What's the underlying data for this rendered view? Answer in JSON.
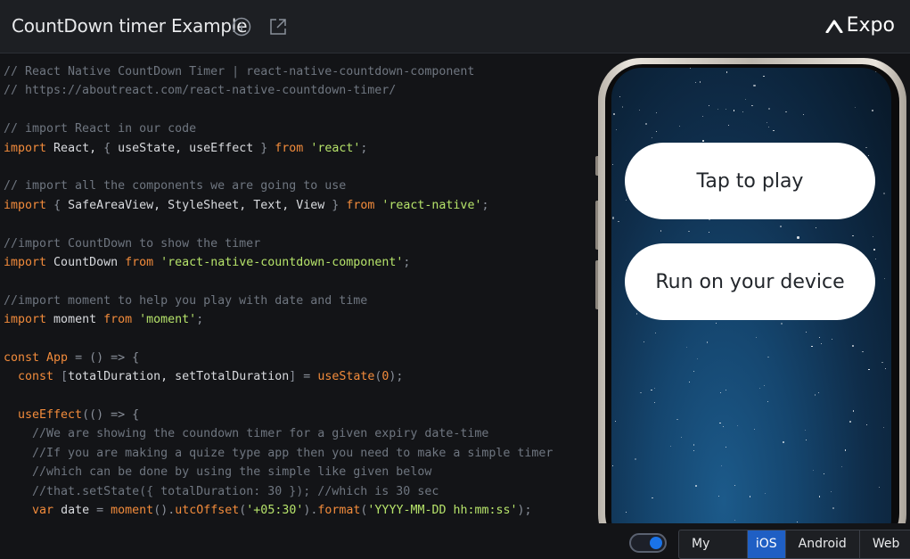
{
  "header": {
    "title": "CountDown timer Example",
    "info_icon": "info-icon",
    "open_icon": "external-link-icon",
    "brand": "Expo"
  },
  "code_lines": [
    [
      {
        "c": "c",
        "t": "// React Native CountDown Timer | react-native-countdown-component"
      }
    ],
    [
      {
        "c": "c",
        "t": "// https://aboutreact.com/react-native-countdown-timer/"
      }
    ],
    [],
    [
      {
        "c": "c",
        "t": "// import React in our code"
      }
    ],
    [
      {
        "c": "k",
        "t": "import"
      },
      {
        "c": "t",
        "t": " React, "
      },
      {
        "c": "p",
        "t": "{"
      },
      {
        "c": "t",
        "t": " useState, useEffect "
      },
      {
        "c": "p",
        "t": "}"
      },
      {
        "c": "t",
        "t": " "
      },
      {
        "c": "k",
        "t": "from"
      },
      {
        "c": "t",
        "t": " "
      },
      {
        "c": "s",
        "t": "'react'"
      },
      {
        "c": "p",
        "t": ";"
      }
    ],
    [],
    [
      {
        "c": "c",
        "t": "// import all the components we are going to use"
      }
    ],
    [
      {
        "c": "k",
        "t": "import"
      },
      {
        "c": "t",
        "t": " "
      },
      {
        "c": "p",
        "t": "{"
      },
      {
        "c": "t",
        "t": " SafeAreaView, StyleSheet, Text, View "
      },
      {
        "c": "p",
        "t": "}"
      },
      {
        "c": "t",
        "t": " "
      },
      {
        "c": "k",
        "t": "from"
      },
      {
        "c": "t",
        "t": " "
      },
      {
        "c": "s",
        "t": "'react-native'"
      },
      {
        "c": "p",
        "t": ";"
      }
    ],
    [],
    [
      {
        "c": "c",
        "t": "//import CountDown to show the timer"
      }
    ],
    [
      {
        "c": "k",
        "t": "import"
      },
      {
        "c": "t",
        "t": " CountDown "
      },
      {
        "c": "k",
        "t": "from"
      },
      {
        "c": "t",
        "t": " "
      },
      {
        "c": "s",
        "t": "'react-native-countdown-component'"
      },
      {
        "c": "p",
        "t": ";"
      }
    ],
    [],
    [
      {
        "c": "c",
        "t": "//import moment to help you play with date and time"
      }
    ],
    [
      {
        "c": "k",
        "t": "import"
      },
      {
        "c": "t",
        "t": " moment "
      },
      {
        "c": "k",
        "t": "from"
      },
      {
        "c": "t",
        "t": " "
      },
      {
        "c": "s",
        "t": "'moment'"
      },
      {
        "c": "p",
        "t": ";"
      }
    ],
    [],
    [
      {
        "c": "k",
        "t": "const"
      },
      {
        "c": "t",
        "t": " "
      },
      {
        "c": "f",
        "t": "App"
      },
      {
        "c": "t",
        "t": " "
      },
      {
        "c": "p",
        "t": "= () =>"
      },
      {
        "c": "t",
        "t": " "
      },
      {
        "c": "p",
        "t": "{"
      }
    ],
    [
      {
        "c": "t",
        "t": "  "
      },
      {
        "c": "k",
        "t": "const"
      },
      {
        "c": "t",
        "t": " "
      },
      {
        "c": "p",
        "t": "["
      },
      {
        "c": "t",
        "t": "totalDuration, setTotalDuration"
      },
      {
        "c": "p",
        "t": "]"
      },
      {
        "c": "t",
        "t": " "
      },
      {
        "c": "p",
        "t": "="
      },
      {
        "c": "t",
        "t": " "
      },
      {
        "c": "f",
        "t": "useState"
      },
      {
        "c": "p",
        "t": "("
      },
      {
        "c": "n",
        "t": "0"
      },
      {
        "c": "p",
        "t": ");"
      }
    ],
    [],
    [
      {
        "c": "t",
        "t": "  "
      },
      {
        "c": "f",
        "t": "useEffect"
      },
      {
        "c": "p",
        "t": "(() =>"
      },
      {
        "c": "t",
        "t": " "
      },
      {
        "c": "p",
        "t": "{"
      }
    ],
    [
      {
        "c": "t",
        "t": "    "
      },
      {
        "c": "c",
        "t": "//We are showing the coundown timer for a given expiry date-time"
      }
    ],
    [
      {
        "c": "t",
        "t": "    "
      },
      {
        "c": "c",
        "t": "//If you are making a quize type app then you need to make a simple timer"
      }
    ],
    [
      {
        "c": "t",
        "t": "    "
      },
      {
        "c": "c",
        "t": "//which can be done by using the simple like given below"
      }
    ],
    [
      {
        "c": "t",
        "t": "    "
      },
      {
        "c": "c",
        "t": "//that.setState({ totalDuration: 30 }); //which is 30 sec"
      }
    ],
    [
      {
        "c": "t",
        "t": "    "
      },
      {
        "c": "k",
        "t": "var"
      },
      {
        "c": "t",
        "t": " date "
      },
      {
        "c": "p",
        "t": "="
      },
      {
        "c": "t",
        "t": " "
      },
      {
        "c": "f",
        "t": "moment"
      },
      {
        "c": "p",
        "t": "()."
      },
      {
        "c": "f",
        "t": "utcOffset"
      },
      {
        "c": "p",
        "t": "("
      },
      {
        "c": "s",
        "t": "'+05:30'"
      },
      {
        "c": "p",
        "t": ")."
      },
      {
        "c": "f",
        "t": "format"
      },
      {
        "c": "p",
        "t": "("
      },
      {
        "c": "s",
        "t": "'YYYY-MM-DD hh:mm:ss'"
      },
      {
        "c": "p",
        "t": ");"
      }
    ]
  ],
  "preview": {
    "tap_to_play": "Tap to play",
    "run_on_device": "Run on your device"
  },
  "footer": {
    "toggle_on": true,
    "platforms": [
      "My Device",
      "iOS",
      "Android",
      "Web"
    ],
    "selected_platform": "iOS"
  },
  "colors": {
    "accent": "#1f5fc4",
    "keyword": "#f28b3b",
    "string": "#b6e36a",
    "comment": "#6f7680"
  }
}
